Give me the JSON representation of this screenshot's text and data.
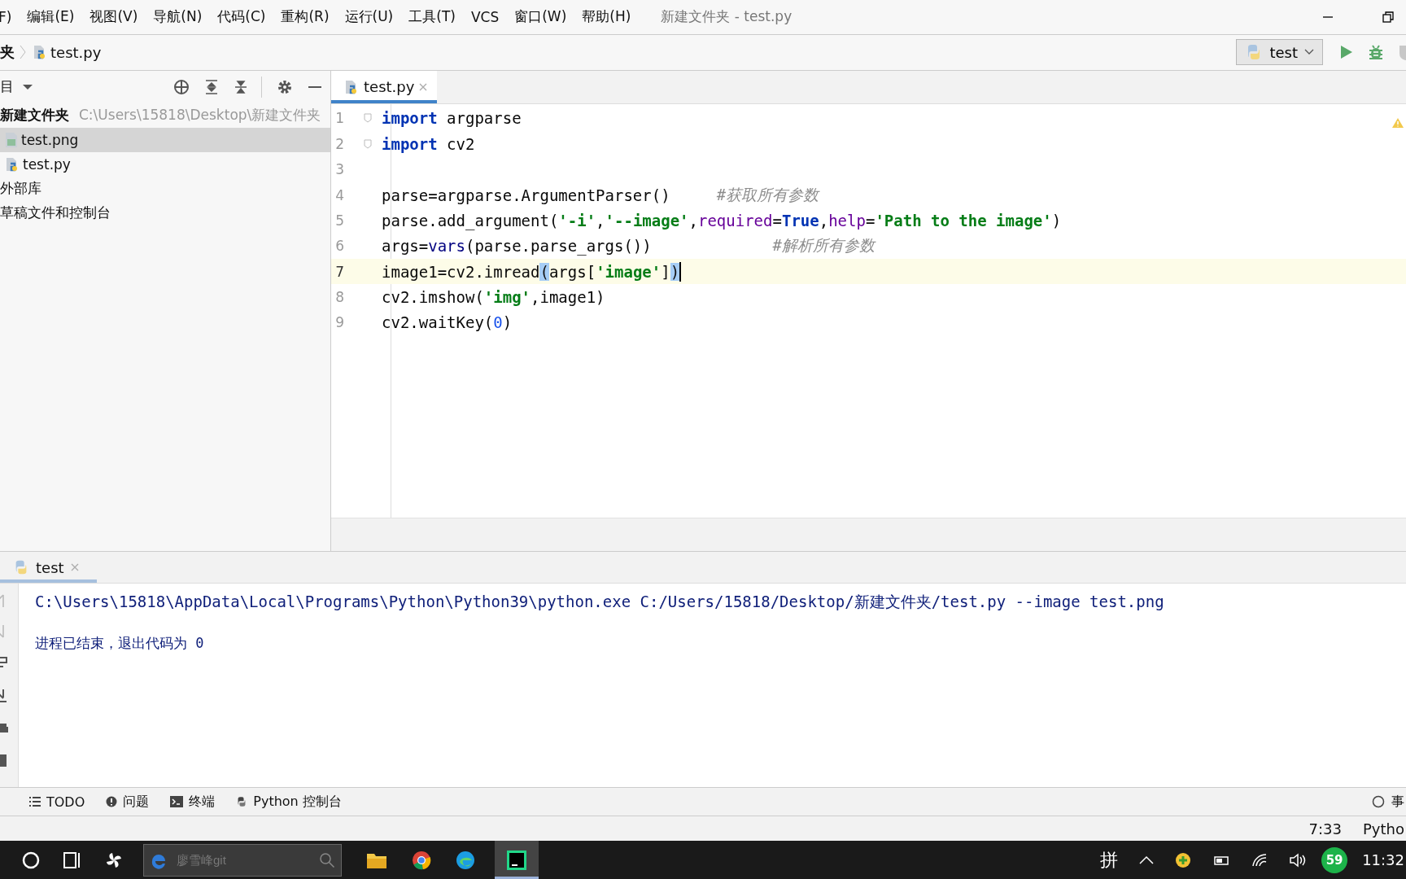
{
  "menu_bar": {
    "items": [
      "F)",
      "编辑(E)",
      "视图(V)",
      "导航(N)",
      "代码(C)",
      "重构(R)",
      "运行(U)",
      "工具(T)",
      "VCS",
      "窗口(W)",
      "帮助(H)"
    ],
    "title": "新建文件夹 - test.py"
  },
  "nav_bar": {
    "breadcrumbs": [
      {
        "label": "夹",
        "kind": "folder"
      },
      {
        "label": "test.py",
        "kind": "python"
      }
    ],
    "run_config": "test"
  },
  "project_panel": {
    "title": "目",
    "tree": [
      {
        "label": "新建文件夹",
        "path": "C:\\Users\\15818\\Desktop\\新建文件夹",
        "kind": "root",
        "selected": false,
        "children": [
          {
            "label": "test.png",
            "kind": "image",
            "selected": true
          },
          {
            "label": "test.py",
            "kind": "python",
            "selected": false
          }
        ]
      },
      {
        "label": "外部库",
        "kind": "plain",
        "selected": false
      },
      {
        "label": "草稿文件和控制台",
        "kind": "plain",
        "selected": false
      }
    ]
  },
  "editor": {
    "tabs": [
      {
        "label": "test.py",
        "selected": true
      }
    ],
    "lines": [
      {
        "number": "1",
        "current": false,
        "tokens": [
          {
            "text": "import",
            "kind": "kw"
          },
          {
            "text": " argparse",
            "kind": "plain"
          }
        ]
      },
      {
        "number": "2",
        "current": false,
        "tokens": [
          {
            "text": "import",
            "kind": "kw"
          },
          {
            "text": " cv2",
            "kind": "plain"
          }
        ]
      },
      {
        "number": "3",
        "current": false
      },
      {
        "number": "4",
        "current": false,
        "tokens": [
          {
            "text": "parse=argparse.ArgumentParser()     ",
            "kind": "plain"
          },
          {
            "text": "#获取所有参数",
            "kind": "comment"
          }
        ]
      },
      {
        "number": "5",
        "current": false,
        "tokens": [
          {
            "text": "parse.add_argument(",
            "kind": "plain"
          },
          {
            "text": "'-i'",
            "kind": "str"
          },
          {
            "text": ",",
            "kind": "plain"
          },
          {
            "text": "'--image'",
            "kind": "str"
          },
          {
            "text": ",",
            "kind": "plain"
          },
          {
            "text": "required",
            "kind": "param"
          },
          {
            "text": "=",
            "kind": "plain"
          },
          {
            "text": "True",
            "kind": "kw"
          },
          {
            "text": ",",
            "kind": "plain"
          },
          {
            "text": "help",
            "kind": "param"
          },
          {
            "text": "=",
            "kind": "plain"
          },
          {
            "text": "'Path to the image'",
            "kind": "str"
          },
          {
            "text": ")",
            "kind": "plain"
          }
        ]
      },
      {
        "number": "6",
        "current": false,
        "tokens": [
          {
            "text": "args=",
            "kind": "plain"
          },
          {
            "text": "vars",
            "kind": "builtin"
          },
          {
            "text": "(parse.parse_args())             ",
            "kind": "plain"
          },
          {
            "text": "#解析所有参数",
            "kind": "comment"
          }
        ]
      },
      {
        "number": "7",
        "current": true,
        "tokens": [
          {
            "text": "image1=cv2.imread",
            "kind": "plain"
          },
          {
            "text": "(",
            "kind": "brace"
          },
          {
            "text": "args[",
            "kind": "plain"
          },
          {
            "text": "'image'",
            "kind": "str"
          },
          {
            "text": "]",
            "kind": "plain"
          },
          {
            "text": ")",
            "kind": "brace"
          }
        ]
      },
      {
        "number": "8",
        "current": false,
        "tokens": [
          {
            "text": "cv2.imshow(",
            "kind": "plain"
          },
          {
            "text": "'img'",
            "kind": "str"
          },
          {
            "text": ",image1)",
            "kind": "plain"
          }
        ]
      },
      {
        "number": "9",
        "current": false,
        "tokens": [
          {
            "text": "cv2.waitKey(",
            "kind": "plain"
          },
          {
            "text": "0",
            "kind": "num"
          },
          {
            "text": ")",
            "kind": "plain"
          }
        ]
      }
    ]
  },
  "run_panel": {
    "tabs": [
      {
        "label": "test",
        "selected": true
      }
    ],
    "output": [
      {
        "text": "C:\\Users\\15818\\AppData\\Local\\Programs\\Python\\Python39\\python.exe C:/Users/15818/Desktop/新建文件夹/test.py --image test.png",
        "kind": "command"
      },
      {
        "text": "进程已结束，退出代码为 0",
        "kind": "message"
      }
    ]
  },
  "tool_strip": {
    "items": [
      {
        "label": "TODO",
        "kind": "todo"
      },
      {
        "label": "问题",
        "kind": "problems"
      },
      {
        "label": "终端",
        "kind": "terminal"
      },
      {
        "label": "Python 控制台",
        "kind": "python"
      }
    ],
    "right": "事"
  },
  "status_bar": {
    "position": "7:33",
    "interpreter": "Pytho"
  },
  "taskbar": {
    "search_placeholder": "廖雪峰git",
    "ime": "拼",
    "badge": "59",
    "clock": "11:32"
  }
}
